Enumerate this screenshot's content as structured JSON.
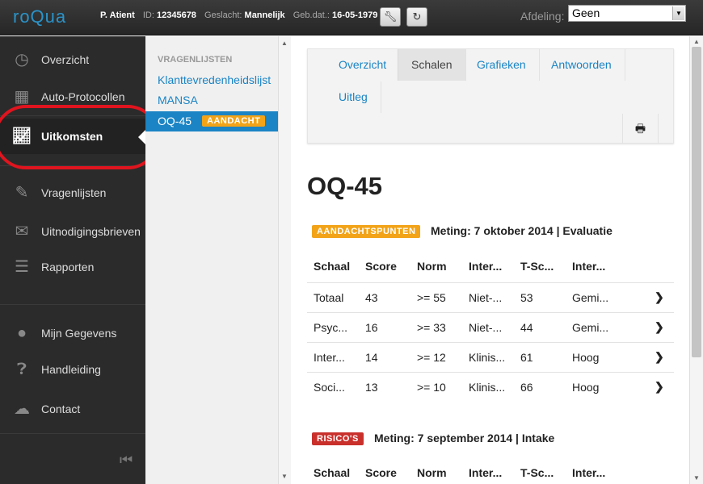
{
  "app": {
    "logo": "roQua"
  },
  "patient": {
    "name": "P. Atient",
    "id_label": "ID:",
    "id_value": "12345678",
    "gender_label": "Geslacht:",
    "gender_value": "Mannelijk",
    "dob_label": "Geb.dat.:",
    "dob_value": "16-05-1979"
  },
  "toolbar": {
    "wrench_icon": "wrench-icon",
    "refresh_icon": "refresh-icon"
  },
  "department": {
    "label": "Afdeling:",
    "selected": "Geen"
  },
  "leftnav": {
    "items": [
      {
        "label": "Overzicht",
        "icon": "dashboard-icon"
      },
      {
        "label": "Auto-Protocollen",
        "icon": "calendar-icon"
      },
      {
        "label": "Uitkomsten",
        "icon": "chart-icon",
        "active": true
      },
      {
        "label": "Vragenlijsten",
        "icon": "pencil-icon"
      },
      {
        "label": "Uitnodigingsbrieven",
        "icon": "envelope-icon"
      },
      {
        "label": "Rapporten",
        "icon": "list-icon"
      },
      {
        "label": "Mijn Gegevens",
        "icon": "user-icon"
      },
      {
        "label": "Handleiding",
        "icon": "help-icon"
      },
      {
        "label": "Contact",
        "icon": "chat-icon"
      }
    ]
  },
  "questionnaires": {
    "header": "VRAGENLIJSTEN",
    "items": [
      {
        "label": "Klanttevredenheidslijst"
      },
      {
        "label": "MANSA"
      },
      {
        "label": "OQ-45",
        "badge": "AANDACHT",
        "active": true
      }
    ]
  },
  "tabs": {
    "items": [
      {
        "label": "Overzicht"
      },
      {
        "label": "Schalen",
        "active": true
      },
      {
        "label": "Grafieken"
      },
      {
        "label": "Antwoorden"
      },
      {
        "label": "Uitleg"
      }
    ],
    "print_icon": "print-icon"
  },
  "main": {
    "title": "OQ-45",
    "measurements": [
      {
        "badge": "AANDACHTSPUNTEN",
        "badge_color": "#f2a318",
        "meta": "Meting: 7 oktober 2014 | Evaluatie",
        "columns": [
          "Schaal",
          "Score",
          "Norm",
          "Inter...",
          "T-Sc...",
          "Inter..."
        ],
        "rows": [
          [
            "Totaal",
            "43",
            ">= 55",
            "Niet-...",
            "53",
            "Gemi..."
          ],
          [
            "Psyc...",
            "16",
            ">= 33",
            "Niet-...",
            "44",
            "Gemi..."
          ],
          [
            "Inter...",
            "14",
            ">= 12",
            "Klinis...",
            "61",
            "Hoog"
          ],
          [
            "Soci...",
            "13",
            ">= 10",
            "Klinis...",
            "66",
            "Hoog"
          ]
        ]
      },
      {
        "badge": "RISICO'S",
        "badge_color": "#c9302c",
        "meta": "Meting: 7 september 2014 | Intake",
        "columns": [
          "Schaal",
          "Score",
          "Norm",
          "Inter...",
          "T-Sc...",
          "Inter..."
        ]
      }
    ]
  },
  "colors": {
    "accent": "#1a84c5",
    "highlight_ring": "#e0141e",
    "sidebar_bg": "#2b2b2b"
  }
}
